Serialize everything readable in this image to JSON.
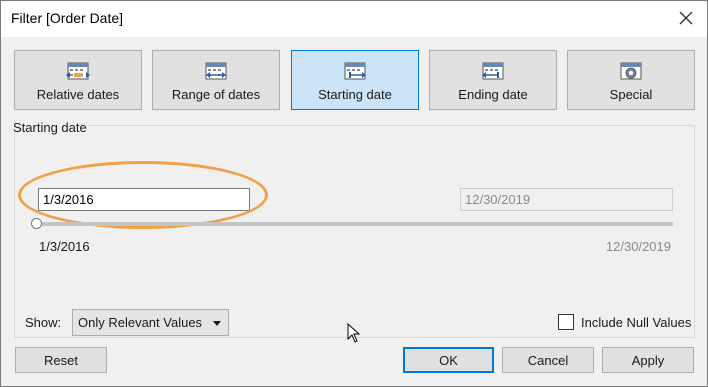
{
  "window": {
    "title": "Filter [Order Date]"
  },
  "tabs": [
    {
      "label": "Relative dates",
      "icon": "relative-dates-icon",
      "active": false
    },
    {
      "label": "Range of dates",
      "icon": "range-of-dates-icon",
      "active": false
    },
    {
      "label": "Starting date",
      "icon": "starting-date-icon",
      "active": true
    },
    {
      "label": "Ending date",
      "icon": "ending-date-icon",
      "active": false
    },
    {
      "label": "Special",
      "icon": "special-icon",
      "active": false
    }
  ],
  "panel": {
    "title": "Starting date",
    "start_value": "1/3/2016",
    "end_value": "12/30/2019",
    "slider_min_label": "1/3/2016",
    "slider_max_label": "12/30/2019",
    "slider_position": 0
  },
  "show": {
    "label": "Show:",
    "selected": "Only Relevant Values"
  },
  "include_null": {
    "label": "Include Null Values",
    "checked": false
  },
  "buttons": {
    "reset": "Reset",
    "ok": "OK",
    "cancel": "Cancel",
    "apply": "Apply"
  },
  "colors": {
    "active_tab_bg": "#cce4f7",
    "accent_border": "#0078d7",
    "highlight_oval": "#f0a045"
  }
}
